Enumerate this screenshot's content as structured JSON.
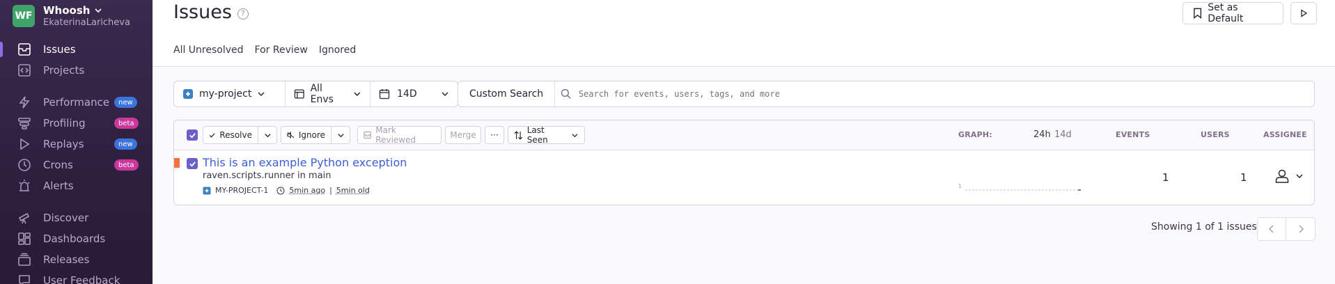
{
  "org": {
    "initials": "WF",
    "name": "Whoosh",
    "user": "EkaterinaLaricheva"
  },
  "nav": {
    "issues": "Issues",
    "projects": "Projects",
    "performance": "Performance",
    "profiling": "Profiling",
    "replays": "Replays",
    "crons": "Crons",
    "alerts": "Alerts",
    "discover": "Discover",
    "dashboards": "Dashboards",
    "releases": "Releases",
    "user_feedback": "User Feedback",
    "badge_new": "new",
    "badge_beta": "beta"
  },
  "header": {
    "title": "Issues",
    "help": "?",
    "set_default": "Set as Default",
    "tabs": [
      "All Unresolved",
      "For Review",
      "Ignored"
    ]
  },
  "filters": {
    "project": "my-project",
    "env": "All Envs",
    "period": "14D"
  },
  "search": {
    "custom": "Custom Search",
    "placeholder": "Search for events, users, tags, and more"
  },
  "toolbar": {
    "resolve": "Resolve",
    "ignore": "Ignore",
    "mark_reviewed": "Mark Reviewed",
    "merge": "Merge",
    "more": "···",
    "sort": "Last Seen"
  },
  "columns": {
    "graph": "GRAPH:",
    "p24h": "24h",
    "p14d": "14d",
    "events": "EVENTS",
    "users": "USERS",
    "assignee": "ASSIGNEE"
  },
  "issue": {
    "title": "This is an example Python exception",
    "culprit": "raven.scripts.runner in main",
    "short_id": "MY-PROJECT-1",
    "last_seen": "5min ago",
    "first_seen": "5min old",
    "spark_label": "1",
    "events": "1",
    "users": "1"
  },
  "pagination": {
    "text": "Showing 1 of 1 issues"
  },
  "colors": {
    "accent": "#6c5fc7",
    "link": "#3c5fd6",
    "level_error": "#f4733b",
    "new_badge": "#3c74dd",
    "beta_badge": "#c9389a"
  }
}
